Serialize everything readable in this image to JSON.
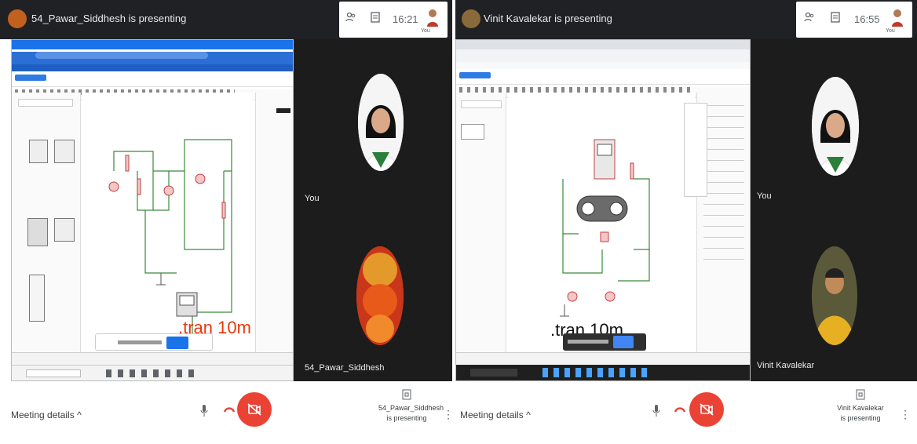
{
  "left": {
    "presenter_title": "54_Pawar_Siddhesh is presenting",
    "time": "16:21",
    "you_label": "You",
    "tile_you": "You",
    "tile_other": "54_Pawar_Siddhesh",
    "annotation": ".tran 10m",
    "meeting_details": "Meeting details",
    "presenting_line1": "54_Pawar_Siddhesh",
    "presenting_line2": "is presenting"
  },
  "right": {
    "presenter_title": "Vinit Kavalekar is presenting",
    "time": "16:55",
    "you_label": "You",
    "tile_you": "You",
    "tile_other": "Vinit Kavalekar",
    "annotation": ".tran 10m",
    "meeting_details": "Meeting details",
    "presenting_line1": "Vinit Kavalekar",
    "presenting_line2": "is presenting"
  },
  "colors": {
    "meet_dark": "#202124",
    "hangup": "#ea4335",
    "accent_blue": "#1a73e8",
    "annotation_red": "#e8380d"
  },
  "icons": [
    "people-icon",
    "chat-icon",
    "mic-icon",
    "hangup-icon",
    "camera-off-icon",
    "present-icon",
    "more-icon",
    "chevron-up-icon"
  ]
}
